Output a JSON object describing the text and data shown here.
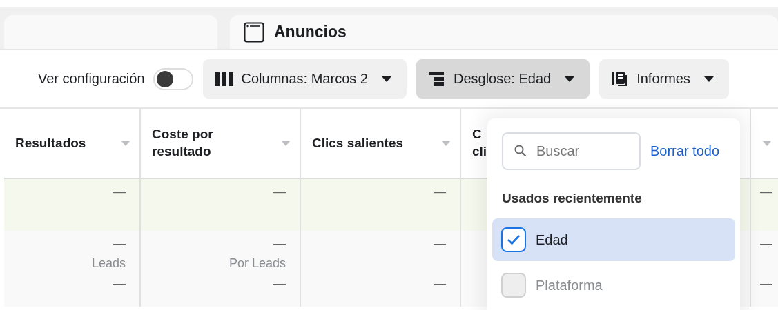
{
  "tabs": [
    {
      "kind": "blank"
    },
    {
      "kind": "ads",
      "label": "Anuncios"
    }
  ],
  "toolbar": {
    "toggle_label": "Ver configuración",
    "toggle_on": false,
    "buttons": [
      {
        "kind": "columns",
        "label": "Columnas: Marcos 2",
        "selected": false
      },
      {
        "kind": "breakdown",
        "label": "Desglose: Edad",
        "selected": true
      },
      {
        "kind": "reports",
        "label": "Informes",
        "selected": false
      }
    ]
  },
  "table": {
    "columns": [
      {
        "label": "Resultados",
        "sortable": true
      },
      {
        "label": "Coste por resultado",
        "sortable": true
      },
      {
        "label": "Clics salientes",
        "sortable": true
      },
      {
        "label": "C cli"
      },
      {
        "sortable": true
      }
    ],
    "rows": [
      {
        "kind": "summary",
        "cells": [
          {
            "main": "—"
          },
          {
            "main": "—"
          },
          {
            "main": "—"
          },
          {},
          {
            "main": "—"
          }
        ]
      },
      {
        "kind": "plain",
        "cells": [
          {
            "main": "—",
            "sub": "Leads",
            "extra": "—"
          },
          {
            "main": "—",
            "sub": "Por Leads",
            "extra": "—"
          },
          {
            "main": "—",
            "extra": "—"
          },
          {},
          {
            "main": "—",
            "extra": "—"
          }
        ]
      }
    ]
  },
  "dropdown": {
    "search": {
      "placeholder": "Buscar"
    },
    "clear_link": "Borrar todo",
    "section": "Usados recientemente",
    "items": [
      {
        "label": "Edad",
        "checked": true,
        "selected": true
      },
      {
        "label": "Plataforma",
        "checked": false,
        "selected": false
      }
    ]
  }
}
